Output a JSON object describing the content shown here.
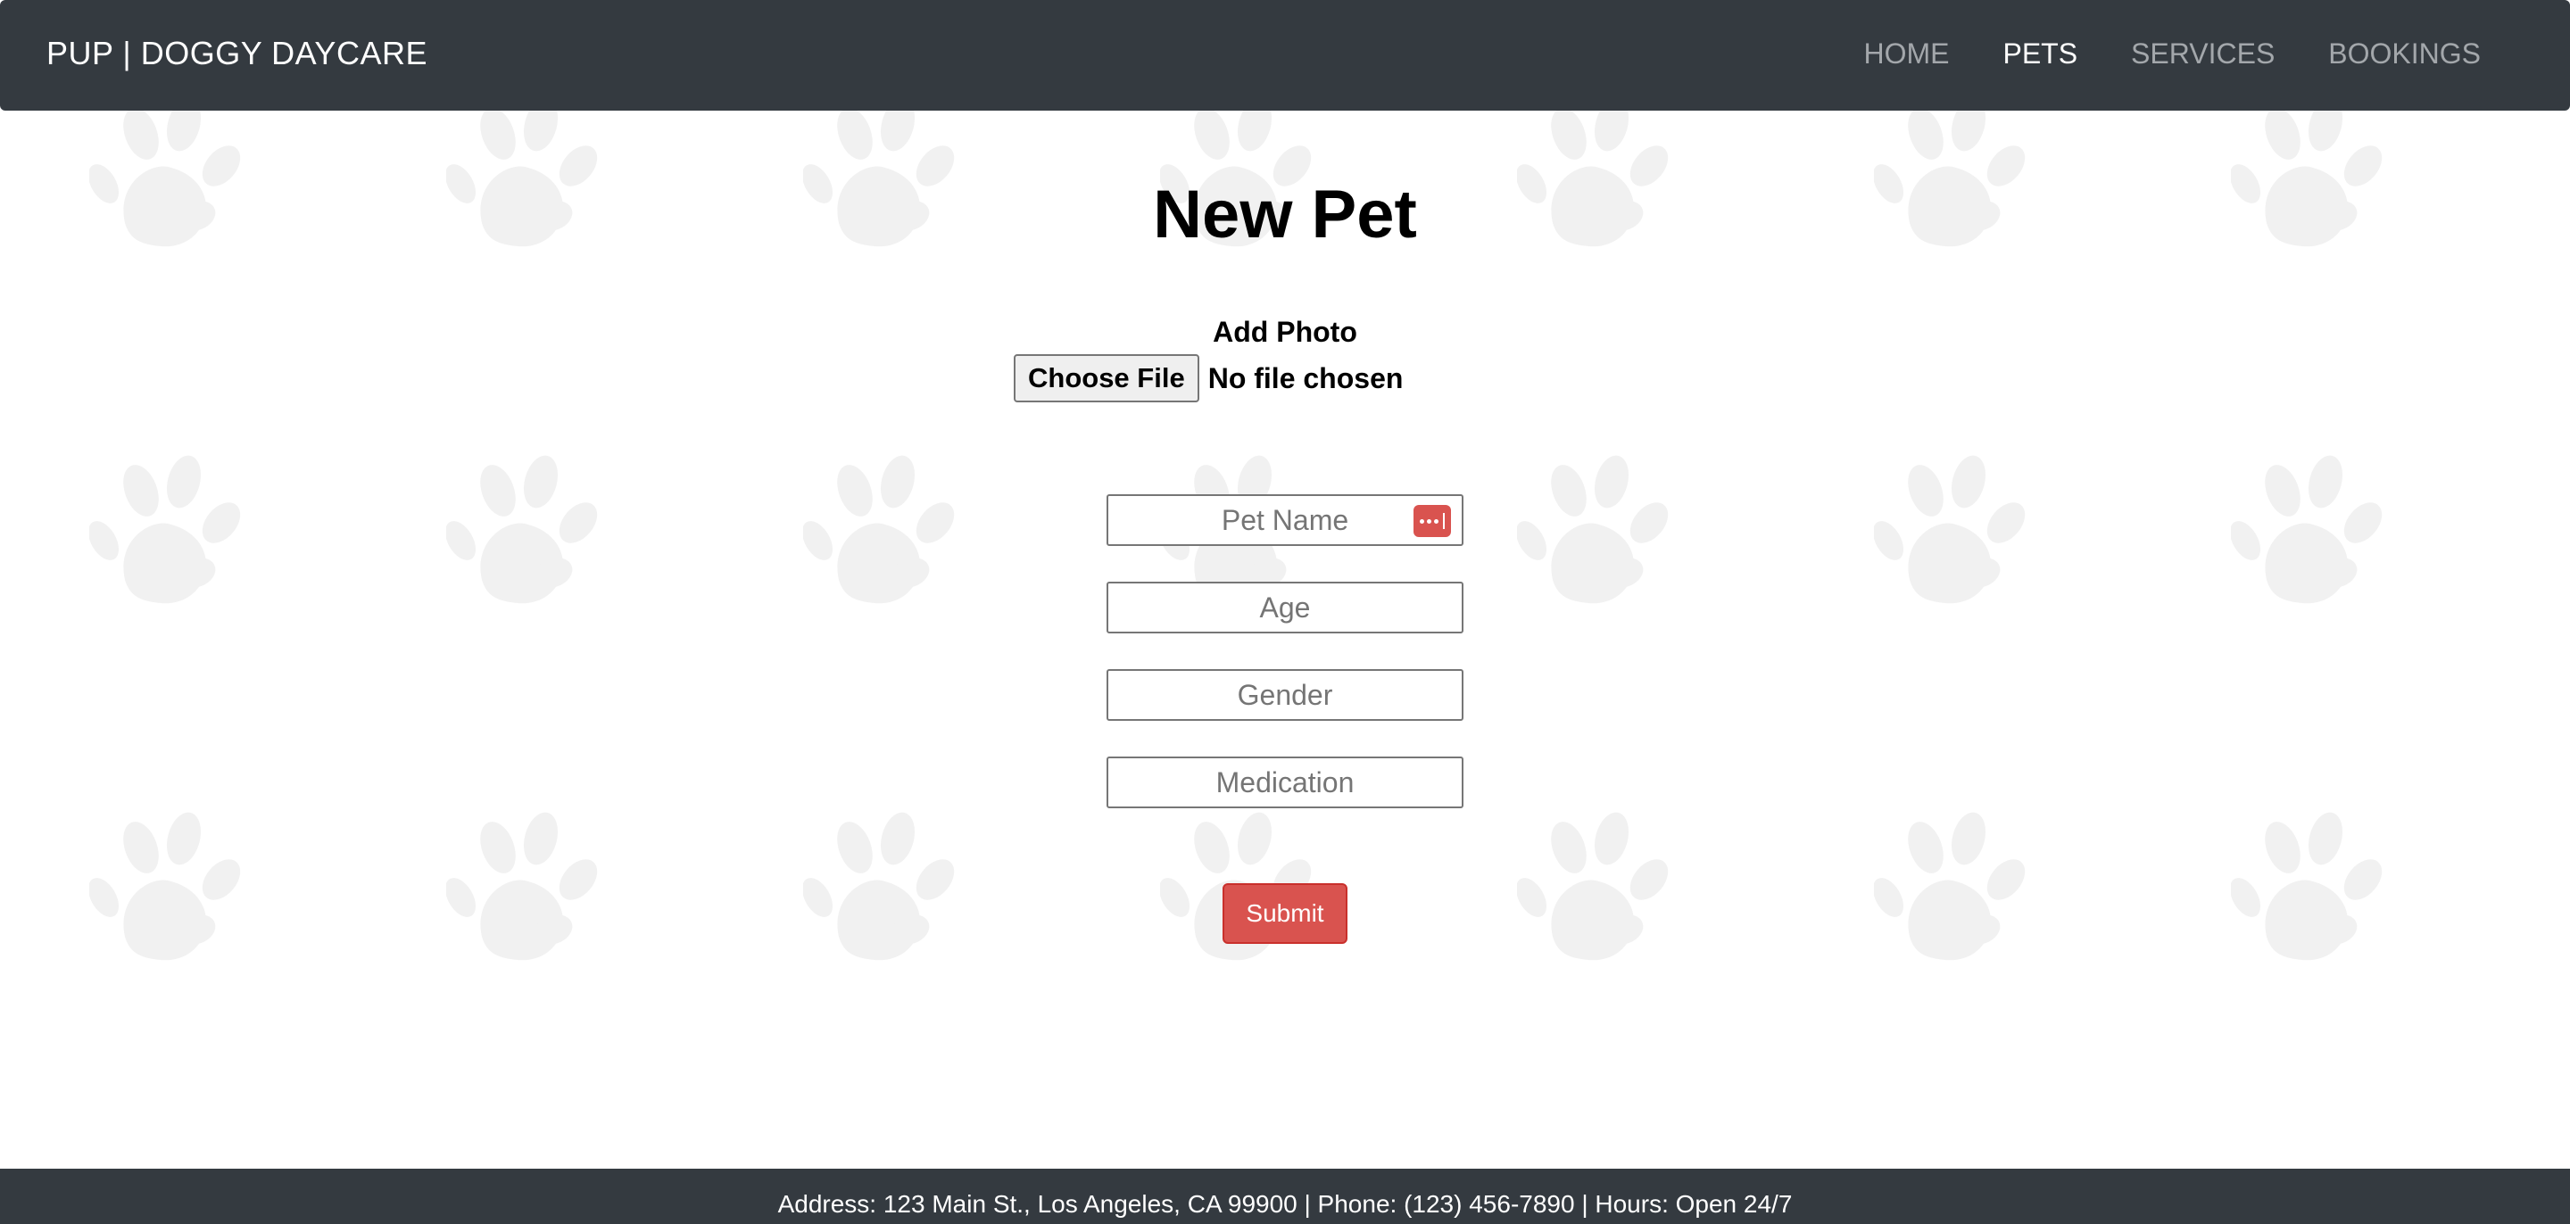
{
  "navbar": {
    "brand": "PUP | DOGGY DAYCARE",
    "links": [
      {
        "label": "HOME",
        "active": false
      },
      {
        "label": "PETS",
        "active": true
      },
      {
        "label": "SERVICES",
        "active": false
      },
      {
        "label": "BOOKINGS",
        "active": false
      }
    ]
  },
  "main": {
    "title": "New Pet",
    "photo": {
      "label": "Add Photo",
      "button_label": "Choose File",
      "status": "No file chosen"
    },
    "fields": [
      {
        "placeholder": "Pet Name",
        "value": ""
      },
      {
        "placeholder": "Age",
        "value": ""
      },
      {
        "placeholder": "Gender",
        "value": ""
      },
      {
        "placeholder": "Medication",
        "value": ""
      }
    ],
    "submit_label": "Submit"
  },
  "footer": {
    "text": "Address: 123 Main St., Los Angeles, CA 99900 | Phone: (123) 456-7890 | Hours: Open 24/7"
  },
  "icons": {
    "background": "paw-print-icon",
    "password_manager": "password-manager-icon"
  },
  "colors": {
    "navbar_bg": "#343a40",
    "nav_active": "#ffffff",
    "nav_inactive": "#a3a7ab",
    "accent": "#d9534f",
    "paw": "#f1f1f1"
  }
}
